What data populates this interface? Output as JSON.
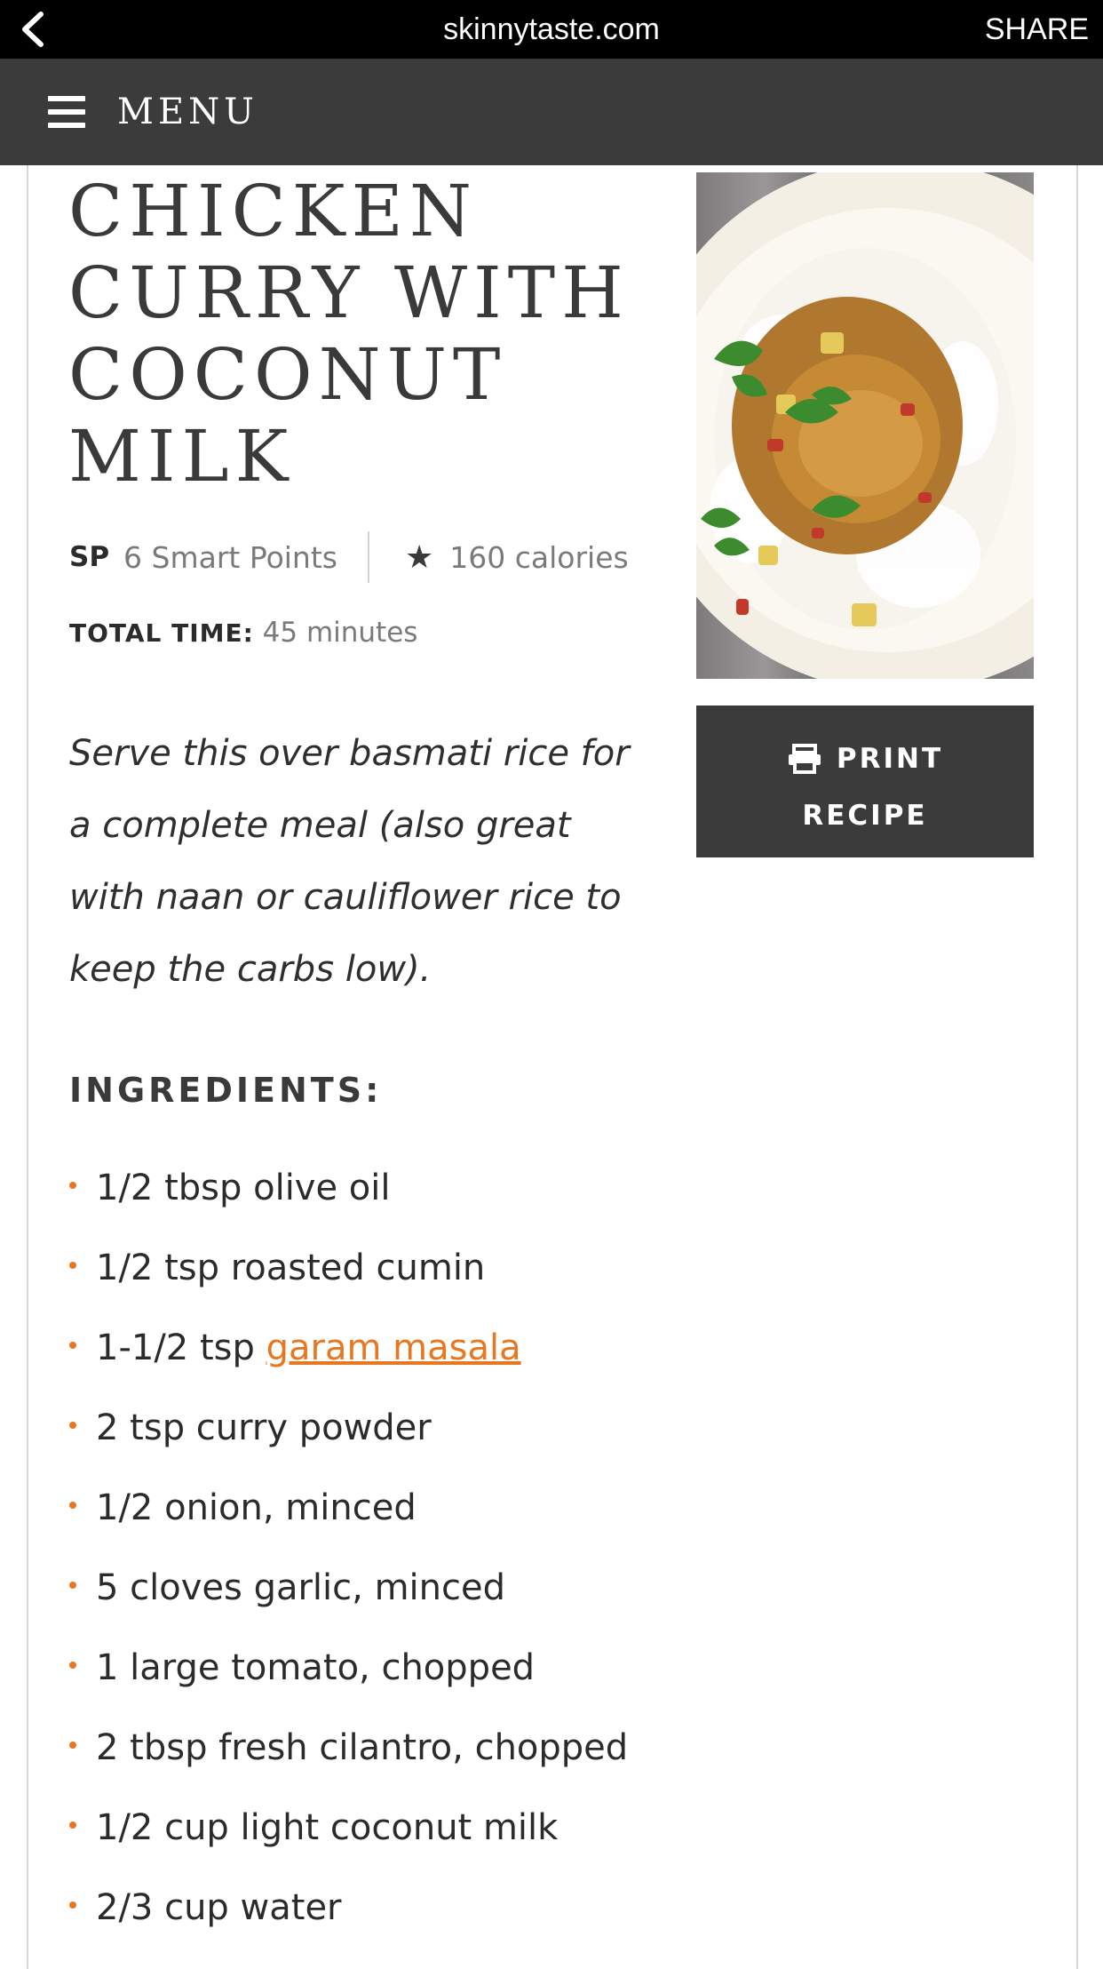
{
  "browser": {
    "domain": "skinnytaste.com",
    "share_label": "SHARE"
  },
  "nav": {
    "menu_label": "MENU"
  },
  "recipe": {
    "title": "CHICKEN CURRY WITH COCONUT MILK",
    "sp_tag": "SP",
    "smart_points": "6 Smart Points",
    "calories": "160 calories",
    "total_time_label": "TOTAL TIME:",
    "total_time_value": "45 minutes",
    "summary": "Serve this over basmati rice for a complete meal (also great with naan or cauliflower rice to keep the carbs low).",
    "print_line1": "PRINT",
    "print_line2": "RECIPE",
    "ingredients_heading": "INGREDIENTS:",
    "ingredients": [
      {
        "text": "1/2 tbsp olive oil"
      },
      {
        "text": "1/2 tsp roasted cumin"
      },
      {
        "text": "1-1/2 tsp ",
        "link": "garam masala"
      },
      {
        "text": "2 tsp curry powder"
      },
      {
        "text": "1/2 onion, minced"
      },
      {
        "text": "5 cloves garlic, minced"
      },
      {
        "text": "1 large tomato, chopped"
      },
      {
        "text": "2 tbsp fresh cilantro, chopped"
      },
      {
        "text": "1/2 cup light coconut milk"
      },
      {
        "text": "2/3 cup water"
      }
    ]
  },
  "icons": {
    "back": "chevron-left-icon",
    "menu": "hamburger-icon",
    "star": "star-icon",
    "print": "printer-icon"
  },
  "colors": {
    "accent": "#e87722",
    "nav_bg": "#3a3b3a",
    "browser_bar": "#000000"
  }
}
